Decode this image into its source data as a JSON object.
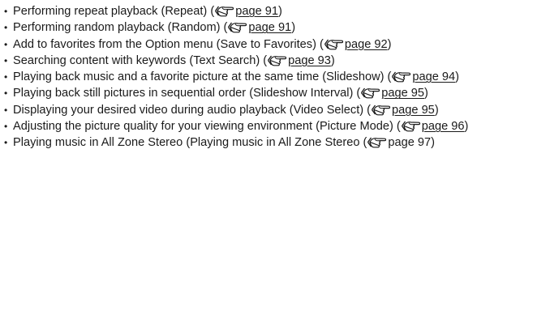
{
  "feature_list": {
    "bullet_char": "•",
    "reference_icon": "hand-pointer-icon",
    "items": [
      {
        "text": "Performing repeat playback (Repeat) (",
        "link": "page 91",
        "suffix": ")",
        "underlined": true
      },
      {
        "text": "Performing random playback (Random) (",
        "link": "page 91",
        "suffix": ")",
        "underlined": true
      },
      {
        "text": "Add to favorites from the Option menu (Save to Favorites) (",
        "link": "page 92",
        "suffix": ")",
        "underlined": true
      },
      {
        "text": "Searching content with keywords (Text Search) (",
        "link": "page 93",
        "suffix": ")",
        "underlined": true
      },
      {
        "text": "Playing back music and a favorite picture at the same time (Slideshow) (",
        "link": "page 94",
        "suffix": ")",
        "underlined": true
      },
      {
        "text": "Playing back still pictures in sequential order (Slideshow Interval) (",
        "link": "page 95",
        "suffix": ")",
        "underlined": true
      },
      {
        "text": "Displaying your desired video during audio playback (Video Select) (",
        "link": "page 95",
        "suffix": ")",
        "underlined": true
      },
      {
        "text": "Adjusting the picture quality for your viewing environment (Picture Mode) (",
        "link": "page 96",
        "suffix": ")",
        "underlined": true
      },
      {
        "text": "Playing music in All Zone Stereo (Playing music in All Zone Stereo (",
        "link": "page 97",
        "suffix": ")",
        "underlined": false
      }
    ]
  }
}
